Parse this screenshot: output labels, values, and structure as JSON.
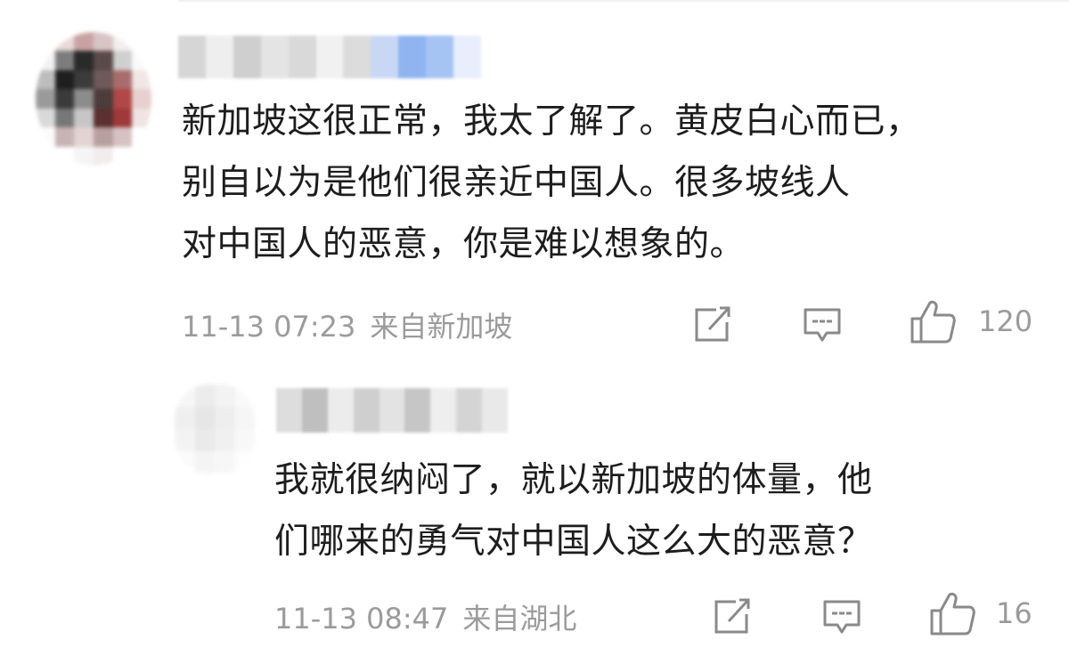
{
  "comments": [
    {
      "author_hidden": true,
      "text_lines": [
        "新加坡这很正常，我太了解了。黄皮白心而已，",
        "别自以为是他们很亲近中国人。很多坡线人",
        "对中国人的恶意，你是难以想象的。"
      ],
      "time": "11-13 07:23",
      "location": "来自新加坡",
      "likes": "120",
      "icons": [
        "share-icon",
        "reply-icon",
        "like-icon"
      ]
    },
    {
      "author_hidden": true,
      "text_lines": [
        "我就很纳闷了，就以新加坡的体量，他",
        "们哪来的勇气对中国人这么大的恶意？"
      ],
      "time": "11-13 08:47",
      "location": "来自湖北",
      "likes": "16",
      "icons": [
        "share-icon",
        "reply-icon",
        "like-icon"
      ]
    }
  ],
  "colors": {
    "text": "#1d1d1d",
    "meta": "#9b9b9b",
    "icon": "#8a8a8a",
    "name_blur_blue": "#8fb4ef"
  }
}
